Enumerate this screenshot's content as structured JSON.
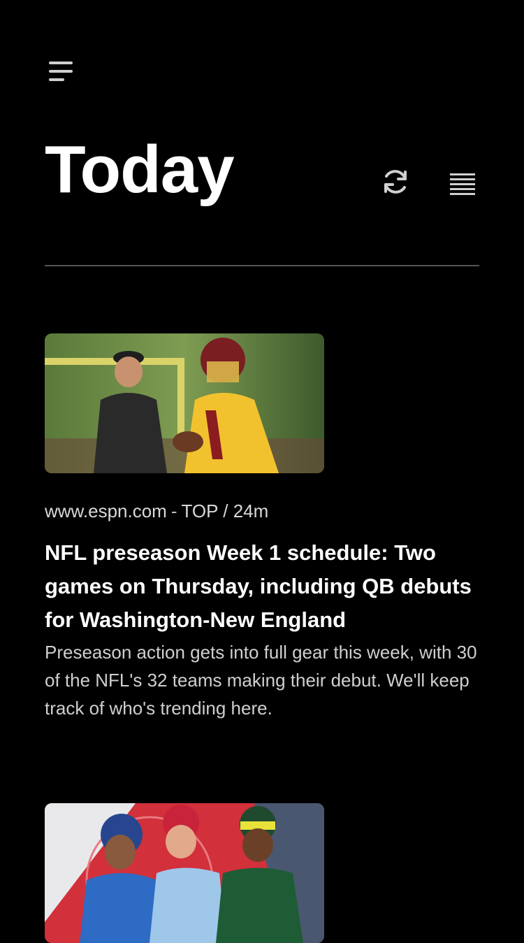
{
  "header": {
    "title": "Today",
    "menu_icon": "hamburger-menu-icon",
    "refresh_icon": "refresh-icon",
    "list_icon": "list-view-icon"
  },
  "articles": [
    {
      "source": "www.espn.com",
      "separator": "-",
      "category": "TOP / 24m",
      "headline": "NFL preseason Week 1 schedule: Two games on Thursday, including QB debuts for Washington-New England",
      "summary": "Preseason action gets into full gear this week, with 30 of the NFL's 32 teams making their debut. We'll keep track of who's trending here."
    },
    {
      "source": "",
      "category": "",
      "headline": "",
      "summary": ""
    }
  ],
  "colors": {
    "background": "#000000",
    "text_primary": "#ffffff",
    "text_secondary": "#cfcfcf",
    "divider": "#555555"
  }
}
